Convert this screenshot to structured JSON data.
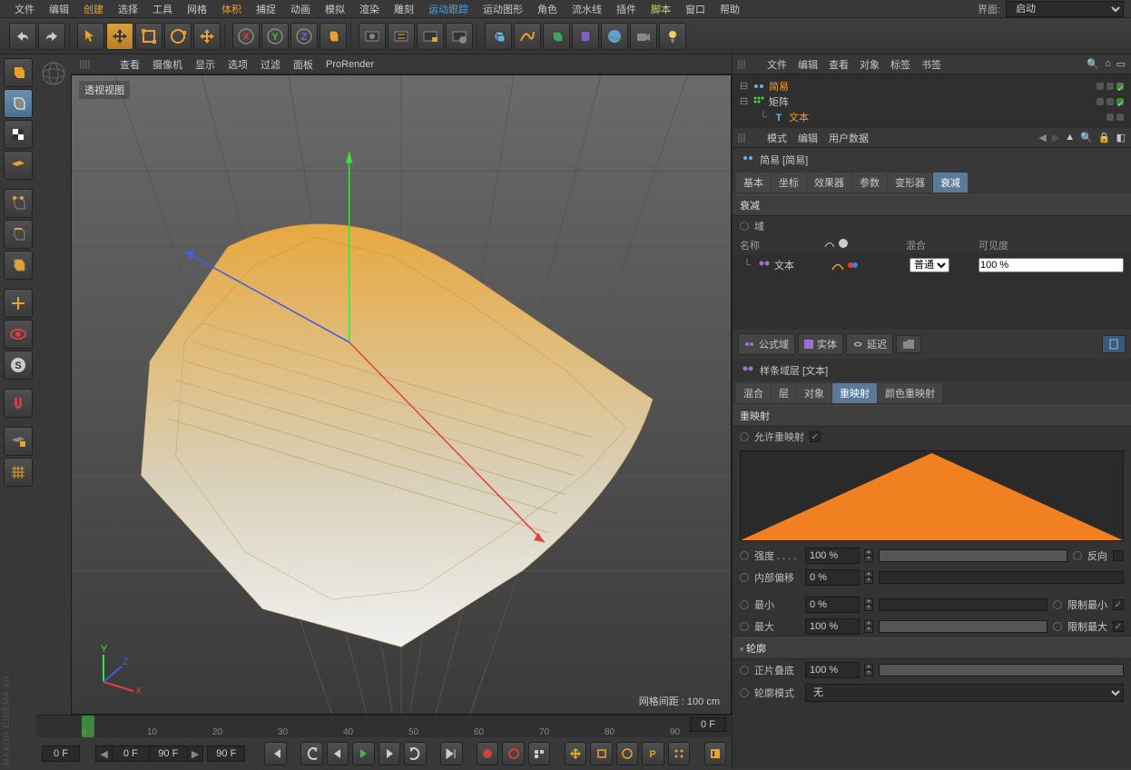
{
  "menubar": {
    "items": [
      "文件",
      "编辑",
      "创建",
      "选择",
      "工具",
      "网格",
      "体积",
      "捕捉",
      "动画",
      "模拟",
      "渲染",
      "雕刻",
      "运动跟踪",
      "运动图形",
      "角色",
      "流水线",
      "插件",
      "脚本",
      "窗口",
      "帮助"
    ],
    "highlight_indices": {
      "2": "highlight-green",
      "6": "highlight-green",
      "12": "highlight-blue",
      "17": "highlight-yellow"
    },
    "right_label": "界面:",
    "right_dropdown": "启动"
  },
  "viewport_menu": [
    "查看",
    "摄像机",
    "显示",
    "选项",
    "过滤",
    "面板",
    "ProRender"
  ],
  "viewport": {
    "label": "透视视图",
    "grid_info": "网格间距 : 100 cm"
  },
  "timeline": {
    "ticks": [
      "0",
      "10",
      "20",
      "30",
      "40",
      "50",
      "60",
      "70",
      "80",
      "90"
    ],
    "frame_current": "0 F",
    "range_start": "0 F",
    "range_a": "0 F",
    "range_b": "90 F",
    "range_end": "90 F"
  },
  "objects_panel": {
    "menus": [
      "文件",
      "编辑",
      "查看",
      "对象",
      "标签",
      "书签"
    ],
    "rows": [
      {
        "indent": 0,
        "name": "简易",
        "highlight": true
      },
      {
        "indent": 0,
        "name": "矩阵",
        "highlight": false
      },
      {
        "indent": 1,
        "name": "文本",
        "highlight": true
      }
    ]
  },
  "attr_panel": {
    "menus": [
      "模式",
      "编辑",
      "用户数据"
    ],
    "title": "简易 [简易]",
    "tabs": [
      "基本",
      "坐标",
      "效果器",
      "参数",
      "变形器",
      "衰减"
    ],
    "active_tab": 5,
    "section_falloff": "衰减",
    "field_label": "域",
    "field_headers": {
      "name": "名称",
      "blend": "混合",
      "vis": "可见度"
    },
    "field_row": {
      "name": "文本",
      "blend_mode": "普通",
      "visibility": "100 %"
    },
    "field_tools": [
      "公式域",
      "实体",
      "延迟"
    ],
    "spline_layer": "样条域层 [文本]",
    "spline_tabs": [
      "混合",
      "层",
      "对象",
      "重映射",
      "颜色重映射"
    ],
    "spline_active_tab": 3,
    "remap_header": "重映射",
    "allow_remap": "允许重映射",
    "strength_label": "强度 . . . .",
    "strength_val": "100 %",
    "invert_label": "反向",
    "inner_offset_label": "内部偏移",
    "inner_offset_val": "0 %",
    "min_label": "最小",
    "min_val": "0 %",
    "clamp_min": "限制最小",
    "max_label": "最大",
    "max_val": "100 %",
    "clamp_max": "限制最大",
    "contour_header": "轮廓",
    "positive_label": "正片叠底",
    "positive_val": "100 %",
    "contour_mode_label": "轮廓模式",
    "contour_mode_val": "无"
  }
}
